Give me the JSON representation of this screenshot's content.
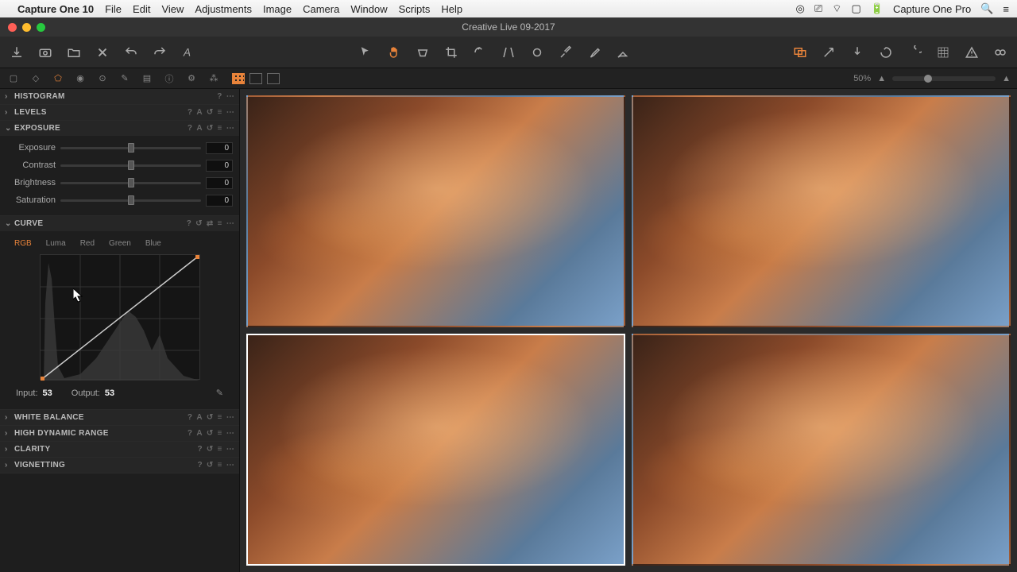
{
  "menubar": {
    "app_name": "Capture One 10",
    "items": [
      "File",
      "Edit",
      "View",
      "Adjustments",
      "Image",
      "Camera",
      "Window",
      "Scripts",
      "Help"
    ],
    "right_app": "Capture One Pro"
  },
  "window": {
    "title": "Creative Live 09-2017"
  },
  "zoom": {
    "percent": "50%"
  },
  "panels": {
    "histogram": {
      "name": "HISTOGRAM"
    },
    "levels": {
      "name": "LEVELS"
    },
    "exposure": {
      "name": "EXPOSURE",
      "rows": [
        {
          "label": "Exposure",
          "value": "0"
        },
        {
          "label": "Contrast",
          "value": "0"
        },
        {
          "label": "Brightness",
          "value": "0"
        },
        {
          "label": "Saturation",
          "value": "0"
        }
      ]
    },
    "curve": {
      "name": "CURVE",
      "tabs": [
        "RGB",
        "Luma",
        "Red",
        "Green",
        "Blue"
      ],
      "input_label": "Input:",
      "input_value": "53",
      "output_label": "Output:",
      "output_value": "53"
    },
    "white_balance": {
      "name": "WHITE BALANCE"
    },
    "hdr": {
      "name": "HIGH DYNAMIC RANGE"
    },
    "clarity": {
      "name": "CLARITY"
    },
    "vignetting": {
      "name": "VIGNETTING"
    }
  },
  "chart_data": {
    "type": "line",
    "title": "RGB Tone Curve",
    "xlabel": "Input",
    "ylabel": "Output",
    "xlim": [
      0,
      255
    ],
    "ylim": [
      0,
      255
    ],
    "series": [
      {
        "name": "curve",
        "x": [
          0,
          255
        ],
        "y": [
          0,
          255
        ]
      }
    ],
    "points": [
      {
        "input": 0,
        "output": 0
      },
      {
        "input": 255,
        "output": 255
      }
    ],
    "histogram_hint": "shadow-heavy with midtone bump"
  }
}
